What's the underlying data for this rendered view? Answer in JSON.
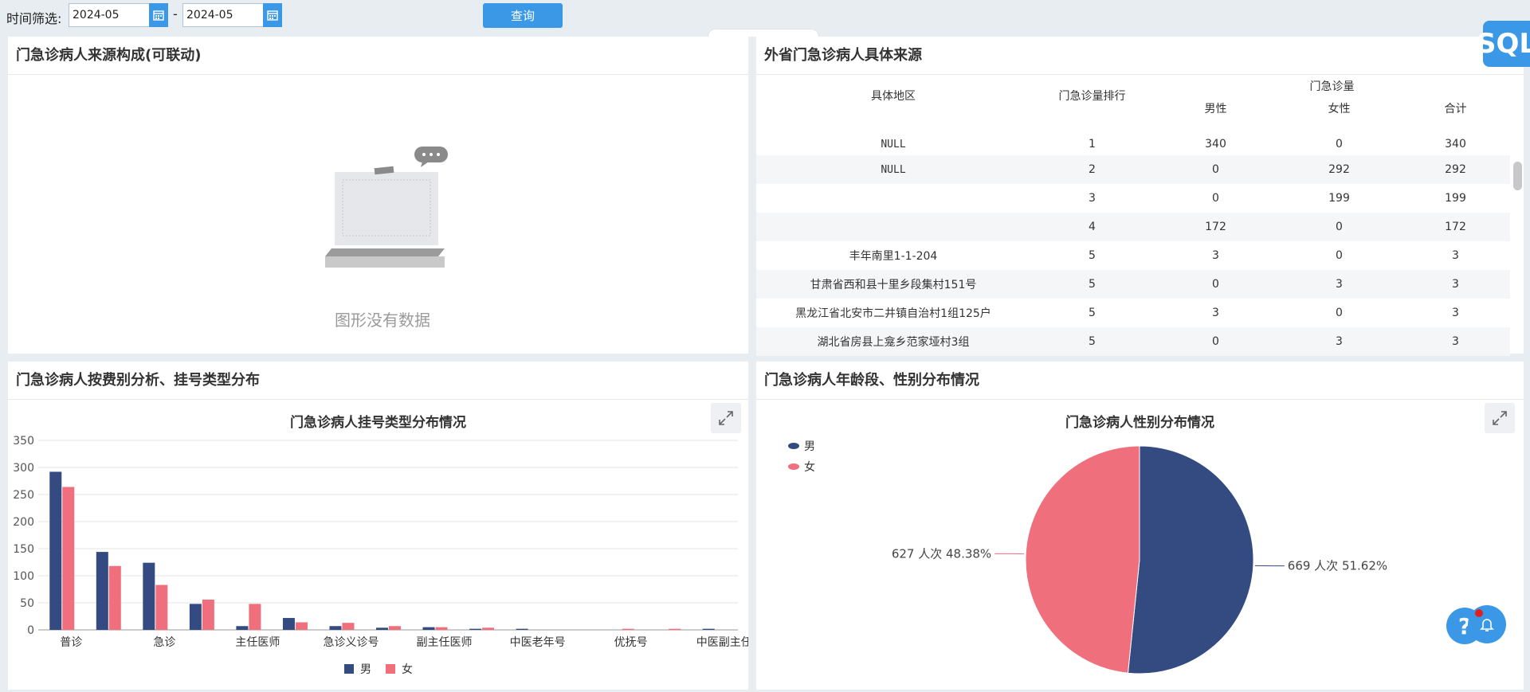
{
  "filter": {
    "label": "时间筛选:",
    "start": "2024-05",
    "end": "2024-05",
    "separator": "-",
    "query_label": "查询"
  },
  "panels": {
    "source": {
      "title": "门急诊病人来源构成(可联动)",
      "empty_text": "图形没有数据"
    },
    "province": {
      "title": "外省门急诊病人具体来源",
      "headers": {
        "region": "具体地区",
        "rank": "门急诊量排行",
        "group": "门急诊量",
        "male": "男性",
        "female": "女性",
        "total": "合计"
      },
      "rows": [
        {
          "region": "NULL",
          "rank": "1",
          "male": "340",
          "female": "0",
          "total": "340"
        },
        {
          "region": "NULL",
          "rank": "2",
          "male": "0",
          "female": "292",
          "total": "292"
        },
        {
          "region": "",
          "rank": "3",
          "male": "0",
          "female": "199",
          "total": "199"
        },
        {
          "region": "",
          "rank": "4",
          "male": "172",
          "female": "0",
          "total": "172"
        },
        {
          "region": "丰年南里1-1-204",
          "rank": "5",
          "male": "3",
          "female": "0",
          "total": "3"
        },
        {
          "region": "甘肃省西和县十里乡段集村151号",
          "rank": "5",
          "male": "0",
          "female": "3",
          "total": "3"
        },
        {
          "region": "黑龙江省北安市二井镇自治村1组125户",
          "rank": "5",
          "male": "3",
          "female": "0",
          "total": "3"
        },
        {
          "region": "湖北省房县上龛乡范家垭村3组",
          "rank": "5",
          "male": "0",
          "female": "3",
          "total": "3"
        }
      ]
    },
    "fee": {
      "title": "门急诊病人按费别分析、挂号类型分布"
    },
    "age": {
      "title": "门急诊病人年龄段、性别分布情况"
    }
  },
  "chart_data": [
    {
      "type": "bar",
      "title": "门急诊病人挂号类型分布情况",
      "categories": [
        "普诊",
        "",
        "急诊",
        "",
        "主任医师",
        "",
        "急诊义诊号",
        "",
        "副主任医师",
        "",
        "中医老年号",
        "",
        "优抚号",
        "",
        "中医副主任"
      ],
      "series": [
        {
          "name": "男",
          "color": "#334b80",
          "values": [
            292,
            144,
            124,
            48,
            7,
            22,
            7,
            4,
            5,
            2,
            2,
            0,
            0,
            0,
            2
          ]
        },
        {
          "name": "女",
          "color": "#ef6f7c",
          "values": [
            264,
            118,
            83,
            56,
            48,
            14,
            13,
            7,
            5,
            4,
            0,
            0,
            2,
            2,
            0
          ]
        }
      ],
      "yticks": [
        "0",
        "50",
        "100",
        "150",
        "200",
        "250",
        "300",
        "350"
      ],
      "ylim": [
        0,
        350
      ],
      "legend": "bottom-center",
      "grid": true
    },
    {
      "type": "pie",
      "title": "门急诊病人性别分布情况",
      "slices": [
        {
          "name": "男",
          "value": 669,
          "label": "669 人次  51.62%",
          "color": "#334b80"
        },
        {
          "name": "女",
          "value": 627,
          "label": "627 人次  48.38%",
          "color": "#ef6f7c"
        }
      ],
      "legend": "top-left"
    }
  ],
  "widgets": {
    "sql_label": "SQL",
    "help_label": "?"
  }
}
